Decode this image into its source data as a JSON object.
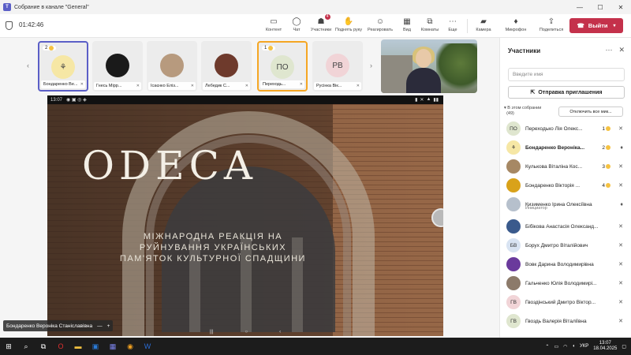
{
  "window": {
    "title": "Собрание в канале \"General\""
  },
  "meeting": {
    "timer": "01:42:46",
    "toolbar": [
      {
        "label": "Контент",
        "icon": "content-icon",
        "glyph": "▢"
      },
      {
        "label": "Чат",
        "icon": "chat-icon",
        "glyph": "💬"
      },
      {
        "label": "Участники",
        "icon": "people-icon",
        "glyph": "👥",
        "badge": "4"
      },
      {
        "label": "Поднять руку",
        "icon": "raise-hand-icon",
        "glyph": "✋"
      },
      {
        "label": "Реагировать",
        "icon": "smile-icon",
        "glyph": "☺"
      },
      {
        "label": "Вид",
        "icon": "grid-view-icon",
        "glyph": "▦"
      },
      {
        "label": "Комнаты",
        "icon": "rooms-icon",
        "glyph": "⧉"
      },
      {
        "label": "Еще",
        "icon": "more-icon",
        "glyph": "⋯"
      },
      {
        "label": "Камера",
        "icon": "camera-icon",
        "glyph": "■"
      },
      {
        "label": "Микрофон",
        "icon": "mic-icon",
        "glyph": "🎙"
      },
      {
        "label": "Поделиться",
        "icon": "share-icon",
        "glyph": "⇪"
      }
    ],
    "leave_label": "Выйти"
  },
  "stage": {
    "tiles": [
      {
        "name": "Бондаренко Ве...",
        "hand": "2",
        "avatar": "",
        "avatar_color": "#f6e7a5"
      },
      {
        "name": "Гнесь Мірр...",
        "avatar": "",
        "avatar_color": "#1a1a1a"
      },
      {
        "name": "Ісаєнко Еліз...",
        "avatar": "",
        "avatar_color": "#b79a7e"
      },
      {
        "name": "Лебедик С...",
        "avatar": "",
        "avatar_color": "#6e3a2c"
      },
      {
        "name": "Переходь...",
        "hand": "1",
        "avatar": "ПО",
        "avatar_color": "#dfe6cf"
      },
      {
        "name": "Русінка Вік...",
        "avatar": "РВ",
        "avatar_color": "#f1d4d7"
      }
    ],
    "share": {
      "status_time": "13:07",
      "title": "ODECA",
      "subtitle": "МІЖНАРОДНА РЕАКЦІЯ НА РУЙНУВАННЯ УКРАЇНСЬКИХ ПАМ'ЯТОК КУЛЬТУРНОЇ СПАДЩИНИ"
    },
    "presenter": "Бондаренко Вероніка Станіславівна"
  },
  "panel": {
    "title": "Участники",
    "search_placeholder": "Введите имя",
    "invite_label": "Отправка приглашения",
    "section_label": "В этом собрании",
    "section_count": "(49)",
    "mute_all_label": "Отключить все мик...",
    "participants": [
      {
        "name": "Переходько Лія Олекс...",
        "avatar": "ПО",
        "color": "#dfe6cf",
        "hand": "1"
      },
      {
        "name": "Бондаренко Вероніка...",
        "avatar": "",
        "color": "#f6e7a5",
        "hand": "2",
        "bold": true
      },
      {
        "name": "Кулькова Віталіна Кос...",
        "avatar": "",
        "color": "#a68864",
        "hand": "3"
      },
      {
        "name": "Бондаренко Вікторія ...",
        "avatar": "",
        "color": "#d9a21a",
        "hand": "4"
      },
      {
        "name": "Кизименко Ірина Олексіївна",
        "avatar": "",
        "color": "#b6c0cc",
        "sub": "Инициатор"
      },
      {
        "name": "Бібікова Анастасія Олександ...",
        "avatar": "",
        "color": "#3a5a8c"
      },
      {
        "name": "Борух Дмитро Віталійович",
        "avatar": "БВ",
        "color": "#d8e3f2"
      },
      {
        "name": "Вовк Дарина Володимирівна",
        "avatar": "",
        "color": "#6a3a9c"
      },
      {
        "name": "Гальченко Юлія Володимирі...",
        "avatar": "",
        "color": "#8c7a6a"
      },
      {
        "name": "Гвоздінський Дмитро Віктор...",
        "avatar": "ГВ",
        "color": "#f1d4d7"
      },
      {
        "name": "Гвоздь Валерія Віталіївна",
        "avatar": "ГВ",
        "color": "#dfe6cf"
      }
    ]
  },
  "taskbar": {
    "lang": "УКР",
    "time": "13:07",
    "date": "18.04.2025"
  }
}
